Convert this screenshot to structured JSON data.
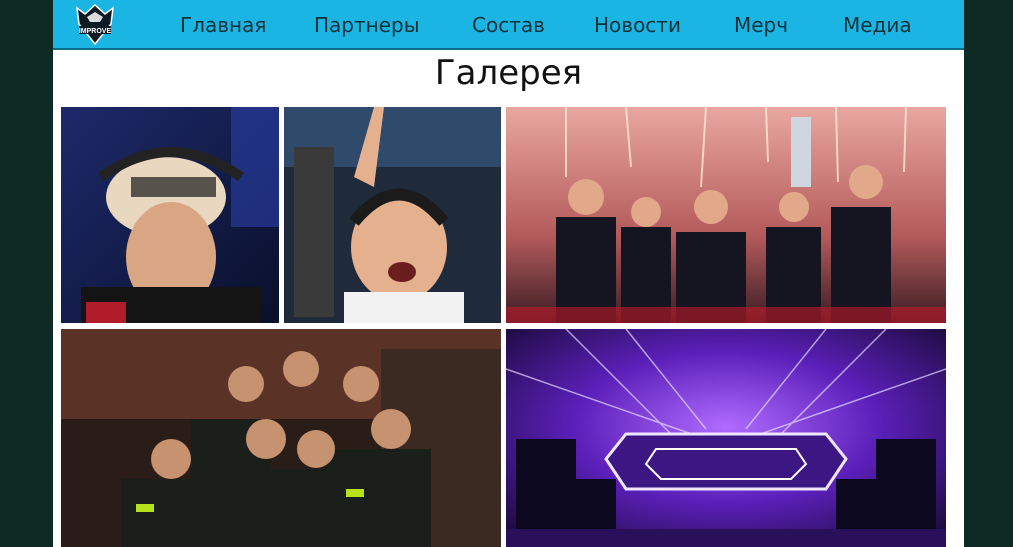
{
  "brand": {
    "logo_text": "IMPROVE"
  },
  "nav": {
    "items": [
      {
        "label": "Главная"
      },
      {
        "label": "Партнеры"
      },
      {
        "label": "Состав"
      },
      {
        "label": "Новости"
      },
      {
        "label": "Мерч"
      },
      {
        "label": "Медиа"
      }
    ]
  },
  "gallery": {
    "title": "Галерея",
    "photos": [
      {
        "icon": "player-headset-photo"
      },
      {
        "icon": "player-celebrating-photo"
      },
      {
        "icon": "team-trophy-photo"
      },
      {
        "icon": "team-group-photo"
      },
      {
        "icon": "arena-stage-photo"
      }
    ]
  },
  "colors": {
    "nav_bg": "#1bb5e3",
    "page_bg": "#ffffff",
    "outer_bg": "#0e2a25"
  }
}
